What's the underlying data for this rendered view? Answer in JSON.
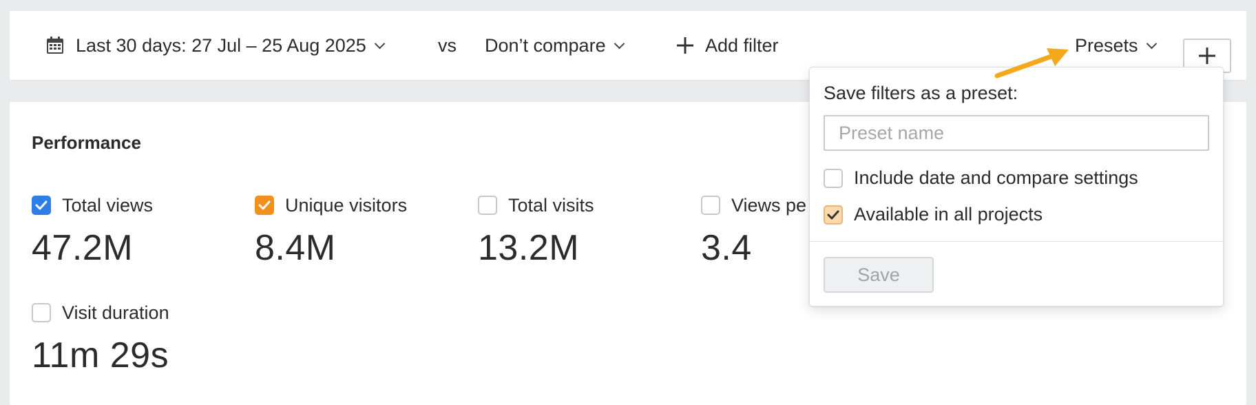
{
  "filter_bar": {
    "date_range": "Last 30 days: 27 Jul – 25 Aug 2025",
    "vs_label": "vs",
    "compare": "Don’t compare",
    "add_filter": "Add filter",
    "presets": "Presets"
  },
  "performance": {
    "title": "Performance",
    "metrics": [
      {
        "label": "Total views",
        "value": "47.2M",
        "checked": true,
        "color": "#2e7ee6"
      },
      {
        "label": "Unique visitors",
        "value": "8.4M",
        "checked": true,
        "color": "#f39019"
      },
      {
        "label": "Total visits",
        "value": "13.2M",
        "checked": false
      },
      {
        "label": "Views pe",
        "value": "3.4",
        "checked": false
      },
      {
        "label": "Visit duration",
        "value": "11m 29s",
        "checked": false
      }
    ]
  },
  "presets_dropdown": {
    "title": "Save filters as a preset:",
    "input_placeholder": "Preset name",
    "input_value": "",
    "options": [
      {
        "label": "Include date and compare settings",
        "checked": false
      },
      {
        "label": "Available in all projects",
        "checked": true
      }
    ],
    "save_label": "Save",
    "save_disabled": true
  },
  "colors": {
    "accent_blue": "#2e7ee6",
    "accent_orange": "#f39019",
    "annotation_arrow": "#f4a81c"
  }
}
